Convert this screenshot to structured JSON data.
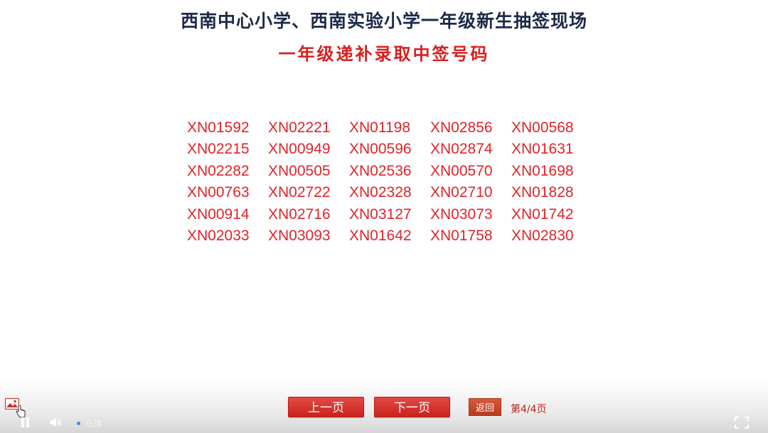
{
  "header": {
    "title": "西南中心小学、西南实验小学一年级新生抽签现场",
    "subtitle": "一年级递补录取中签号码"
  },
  "numbers": [
    [
      "XN01592",
      "XN02221",
      "XN01198",
      "XN02856",
      "XN00568"
    ],
    [
      "XN02215",
      "XN00949",
      "XN00596",
      "XN02874",
      "XN01631"
    ],
    [
      "XN02282",
      "XN00505",
      "XN02536",
      "XN00570",
      "XN01698"
    ],
    [
      "XN00763",
      "XN02722",
      "XN02328",
      "XN02710",
      "XN01828"
    ],
    [
      "XN00914",
      "XN02716",
      "XN03127",
      "XN03073",
      "XN01742"
    ],
    [
      "XN02033",
      "XN03093",
      "XN01642",
      "XN01758",
      "XN02830"
    ]
  ],
  "controls": {
    "prev_label": "上一页",
    "next_label": "下一页",
    "back_label": "返回",
    "page_indicator": "第4/4页",
    "live_label": "直播"
  },
  "colors": {
    "title": "#1c2a4a",
    "subtitle": "#d81e1e",
    "numbers": "#e0242b",
    "button": "#d32f2a"
  },
  "icons": [
    "image-thumbnail-icon",
    "hand-cursor-icon",
    "pause-icon",
    "volume-icon",
    "fullscreen-icon"
  ]
}
